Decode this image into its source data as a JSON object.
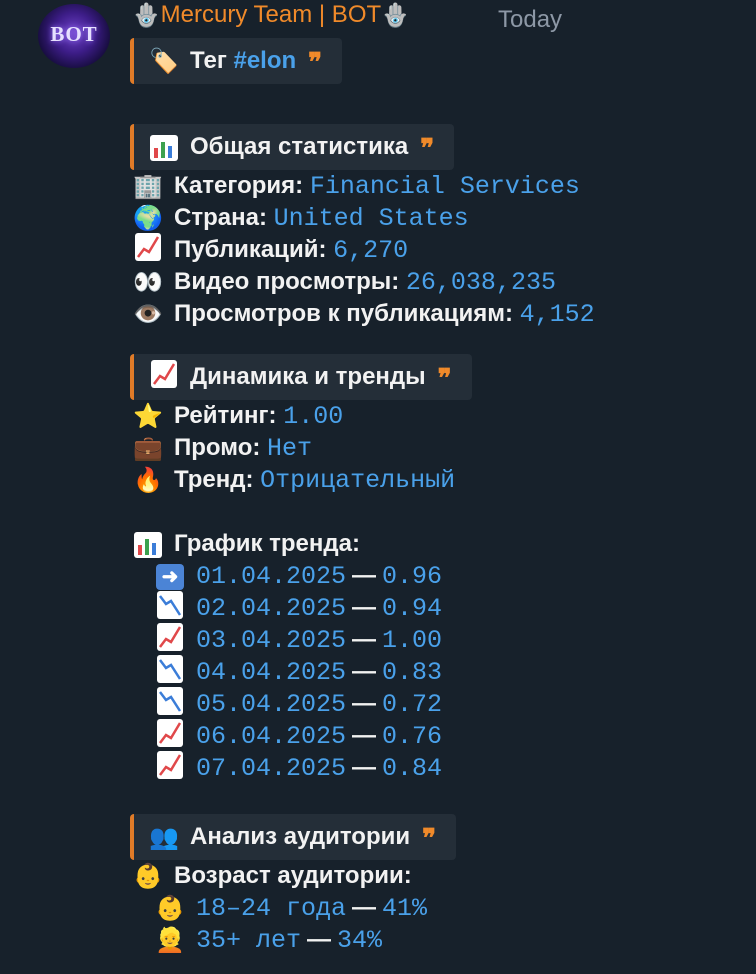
{
  "chat": {
    "sender": "Mercury Team | BOT",
    "sender_decoration": "🪬",
    "time": "Today",
    "avatar_text": "BOT"
  },
  "message": {
    "tag_block": {
      "icon": "🏷️",
      "label": "Тег",
      "value": "#elon",
      "quote": "❞"
    },
    "general": {
      "icon": "bar-chart-icon",
      "title": "Общая статистика",
      "quote": "❞",
      "category": {
        "icon": "🏢",
        "label": "Категория:",
        "value": "Financial Services"
      },
      "country": {
        "icon": "🌍",
        "label": "Страна:",
        "value": "United States"
      },
      "posts": {
        "icon": "chart-up-icon",
        "label": "Публикаций:",
        "value": "6,270"
      },
      "video_views": {
        "icon": "👀",
        "label": "Видео просмотры:",
        "value": "26,038,235"
      },
      "views_per_post": {
        "icon": "👁️",
        "label": "Просмотров к публикациям:",
        "value": "4,152"
      }
    },
    "dynamics": {
      "icon": "chart-up-icon",
      "title": "Динамика и тренды",
      "quote": "❞",
      "rating": {
        "icon": "⭐",
        "label": "Рейтинг:",
        "value": "1.00"
      },
      "promo": {
        "icon": "💼",
        "label": "Промо:",
        "value": "Нет"
      },
      "trend": {
        "icon": "🔥",
        "label": "Тренд:",
        "value": "Отрицательный"
      }
    },
    "trend_chart": {
      "icon": "bar-chart-icon",
      "label": "График тренда:",
      "dash": "—",
      "rows": [
        {
          "icon": "arrow-right-icon",
          "date": "01.04.2025",
          "value": "0.96"
        },
        {
          "icon": "chart-down-icon",
          "date": "02.04.2025",
          "value": "0.94"
        },
        {
          "icon": "chart-up-icon",
          "date": "03.04.2025",
          "value": "1.00"
        },
        {
          "icon": "chart-down-icon",
          "date": "04.04.2025",
          "value": "0.83"
        },
        {
          "icon": "chart-down-icon",
          "date": "05.04.2025",
          "value": "0.72"
        },
        {
          "icon": "chart-up-icon",
          "date": "06.04.2025",
          "value": "0.76"
        },
        {
          "icon": "chart-up-icon",
          "date": "07.04.2025",
          "value": "0.84"
        }
      ]
    },
    "audience": {
      "icon": "👥",
      "title": "Анализ аудитории",
      "quote": "❞",
      "age_label": {
        "icon": "👶",
        "label": "Возраст аудитории:"
      },
      "dash": "—",
      "age_rows": [
        {
          "icon": "👶",
          "range": "18–24 года",
          "value": "41%"
        },
        {
          "icon": "👱",
          "range": "35+ лет",
          "value": "34%"
        }
      ]
    }
  },
  "colors": {
    "background": "#17212b",
    "accent_orange": "#f08a2a",
    "link_blue": "#4aa1ea",
    "quote_bg": "#242e38"
  }
}
